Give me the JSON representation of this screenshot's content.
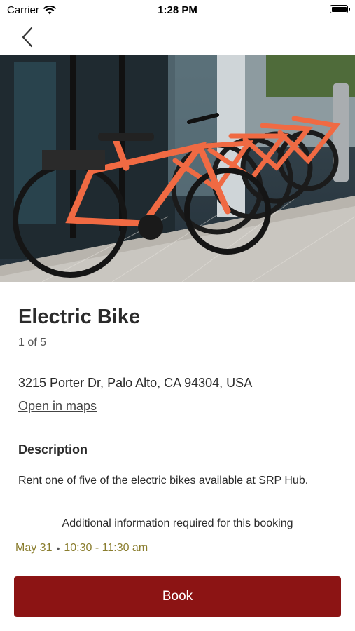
{
  "status_bar": {
    "carrier": "Carrier",
    "time": "1:28 PM"
  },
  "resource": {
    "name": "Electric Bike",
    "count": "1 of 5",
    "address": "3215 Porter Dr, Palo Alto, CA 94304, USA",
    "maps_link": "Open in maps",
    "description_heading": "Description",
    "description": "Rent one of five of the electric bikes available at SRP Hub."
  },
  "booking": {
    "info_note": "Additional information required for this booking",
    "date": "May 31",
    "separator": "•",
    "time": "10:30 - 11:30 am",
    "book_label": "Book"
  },
  "colors": {
    "accent": "#8c1414",
    "link_olive": "#8a7d2e",
    "bike_orange": "#f06a43"
  },
  "icons": [
    "wifi-icon",
    "battery-icon",
    "back-chevron-icon"
  ]
}
